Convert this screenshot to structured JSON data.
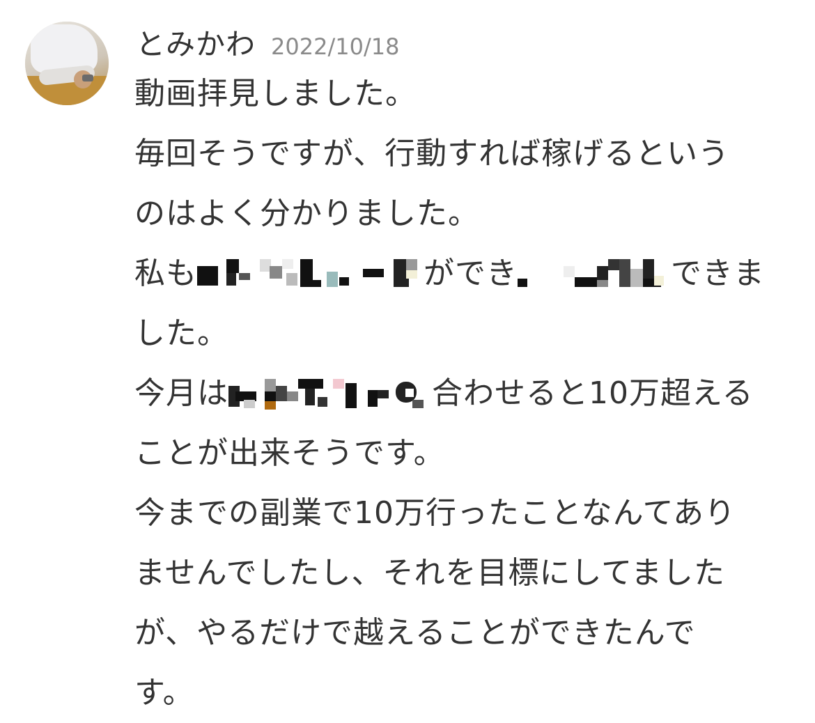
{
  "comment": {
    "author": "とみかわ",
    "date": "2022/10/18",
    "lines": {
      "l1": "動画拝見しました。",
      "l2": "毎回そうですが、行動すれば稼げるという",
      "l3": "のはよく分かりました。",
      "l4_pre": "私も",
      "l4_mid": "ができ",
      "l4_post": "できま",
      "l5": "した。",
      "l6_pre": "今月は",
      "l6_post": "合わせると10万超える",
      "l7": "ことが出来そうです。",
      "l8": "今までの副業で10万行ったことなんてあり",
      "l9": "ませんでしたし、それを目標にしてました",
      "l10": "が、やるだけで越えることができたんで",
      "l11": "す。"
    }
  },
  "icons": {
    "avatar": "user-photo",
    "redaction": "mosaic-blur"
  }
}
